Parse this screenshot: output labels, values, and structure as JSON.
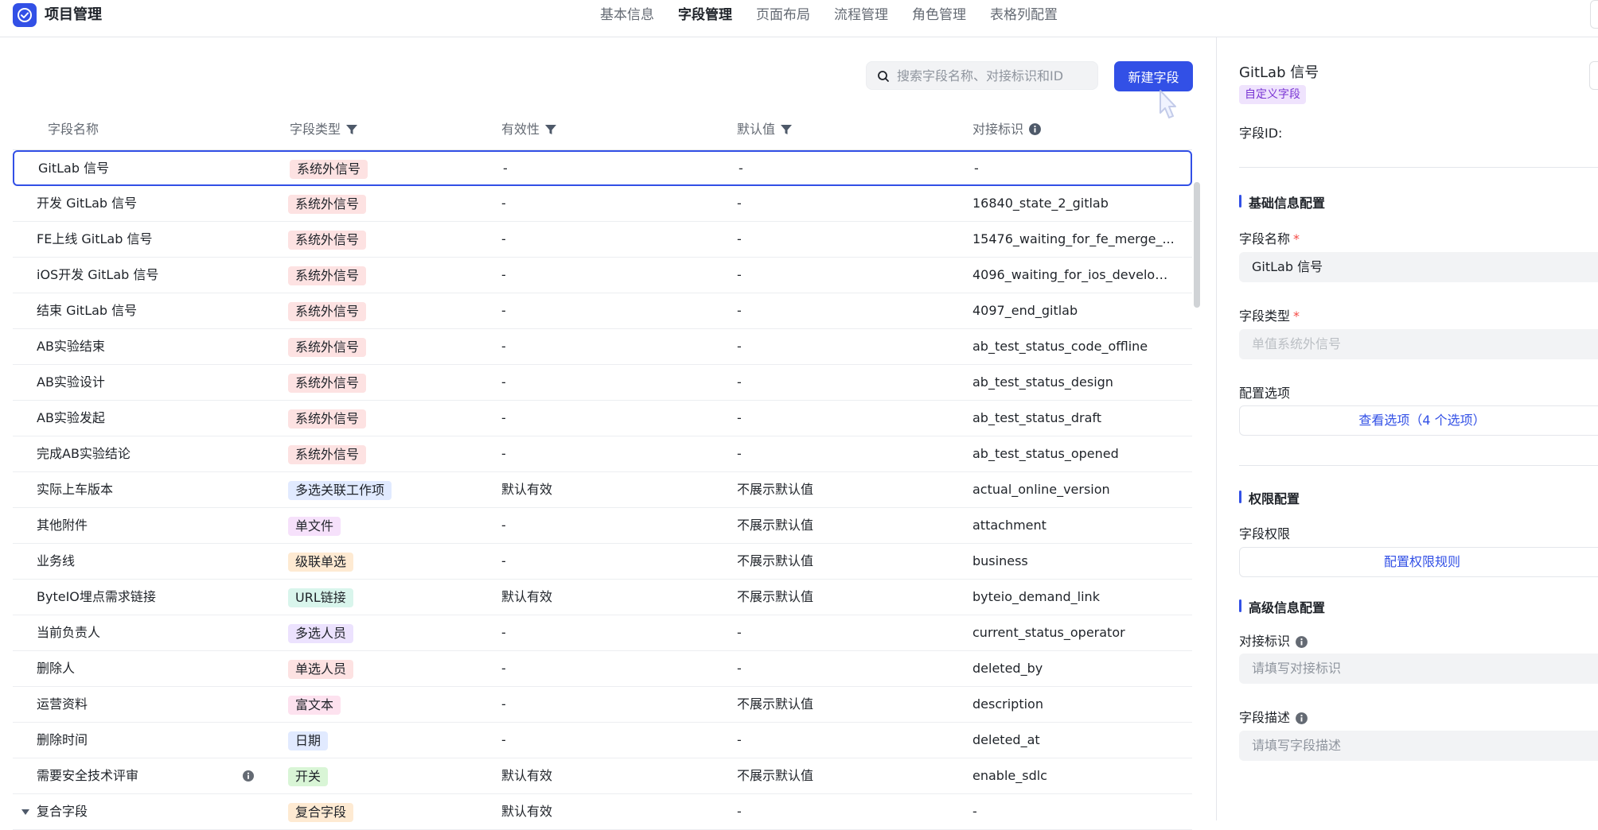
{
  "app": {
    "title": "项目管理"
  },
  "nav": [
    {
      "label": "基本信息",
      "active": false
    },
    {
      "label": "字段管理",
      "active": true
    },
    {
      "label": "页面布局",
      "active": false
    },
    {
      "label": "流程管理",
      "active": false
    },
    {
      "label": "角色管理",
      "active": false
    },
    {
      "label": "表格列配置",
      "active": false
    }
  ],
  "toolbar": {
    "search_placeholder": "搜索字段名称、对接标识和ID",
    "search_value": "",
    "new_button": "新建字段"
  },
  "table": {
    "headers": {
      "name": "字段名称",
      "type": "字段类型",
      "validity": "有效性",
      "default": "默认值",
      "key": "对接标识"
    },
    "rows": [
      {
        "name": "GitLab 信号",
        "type": "系统外信号",
        "validity": "-",
        "default": "-",
        "key": "-"
      },
      {
        "name": "开发 GitLab 信号",
        "type": "系统外信号",
        "validity": "-",
        "default": "-",
        "key": "16840_state_2_gitlab"
      },
      {
        "name": "FE上线 GitLab 信号",
        "type": "系统外信号",
        "validity": "-",
        "default": "-",
        "key": "15476_waiting_for_fe_merge_..."
      },
      {
        "name": "iOS开发 GitLab 信号",
        "type": "系统外信号",
        "validity": "-",
        "default": "-",
        "key": "4096_waiting_for_ios_develop..."
      },
      {
        "name": "结束 GitLab 信号",
        "type": "系统外信号",
        "validity": "-",
        "default": "-",
        "key": "4097_end_gitlab"
      },
      {
        "name": "AB实验结束",
        "type": "系统外信号",
        "validity": "-",
        "default": "-",
        "key": "ab_test_status_code_offline"
      },
      {
        "name": "AB实验设计",
        "type": "系统外信号",
        "validity": "-",
        "default": "-",
        "key": "ab_test_status_design"
      },
      {
        "name": "AB实验发起",
        "type": "系统外信号",
        "validity": "-",
        "default": "-",
        "key": "ab_test_status_draft"
      },
      {
        "name": "完成AB实验结论",
        "type": "系统外信号",
        "validity": "-",
        "default": "-",
        "key": "ab_test_status_opened"
      },
      {
        "name": "实际上车版本",
        "type": "多选关联工作项",
        "validity": "默认有效",
        "default": "不展示默认值",
        "key": "actual_online_version"
      },
      {
        "name": "其他附件",
        "type": "单文件",
        "validity": "-",
        "default": "不展示默认值",
        "key": "attachment"
      },
      {
        "name": "业务线",
        "type": "级联单选",
        "validity": "-",
        "default": "不展示默认值",
        "key": "business"
      },
      {
        "name": "ByteIO埋点需求链接",
        "type": "URL链接",
        "validity": "默认有效",
        "default": "不展示默认值",
        "key": "byteio_demand_link"
      },
      {
        "name": "当前负责人",
        "type": "多选人员",
        "validity": "-",
        "default": "-",
        "key": "current_status_operator"
      },
      {
        "name": "删除人",
        "type": "单选人员",
        "validity": "-",
        "default": "-",
        "key": "deleted_by"
      },
      {
        "name": "运营资料",
        "type": "富文本",
        "validity": "-",
        "default": "不展示默认值",
        "key": "description"
      },
      {
        "name": "删除时间",
        "type": "日期",
        "validity": "-",
        "default": "-",
        "key": "deleted_at"
      },
      {
        "name": "需要安全技术评审",
        "type": "开关",
        "validity": "默认有效",
        "default": "不展示默认值",
        "key": "enable_sdlc"
      },
      {
        "name": "复合字段",
        "type": "复合字段",
        "validity": "默认有效",
        "default": "-",
        "key": "-"
      }
    ]
  },
  "tag_colors": {
    "系统外信号": {
      "bg": "#fde2e2",
      "fg": "#1f2329"
    },
    "多选关联工作项": {
      "bg": "#e1eaff",
      "fg": "#1f2329"
    },
    "单文件": {
      "bg": "#f6e1fb",
      "fg": "#1f2329"
    },
    "级联单选": {
      "bg": "#feead2",
      "fg": "#1f2329"
    },
    "URL链接": {
      "bg": "#d9f5ec",
      "fg": "#1f2329"
    },
    "多选人员": {
      "bg": "#ece2fe",
      "fg": "#1f2329"
    },
    "单选人员": {
      "bg": "#fde2e2",
      "fg": "#1f2329"
    },
    "富文本": {
      "bg": "#fde2ef",
      "fg": "#1f2329"
    },
    "日期": {
      "bg": "#e1eaff",
      "fg": "#1f2329"
    },
    "开关": {
      "bg": "#d9f5d6",
      "fg": "#1f2329"
    },
    "复合字段": {
      "bg": "#feead2",
      "fg": "#1f2329"
    }
  },
  "panel": {
    "title": "GitLab 信号",
    "badge": "自定义字段",
    "field_id_label": "字段ID:",
    "section_basic": "基础信息配置",
    "name_label": "字段名称",
    "name_value": "GitLab 信号",
    "type_label": "字段类型",
    "type_value": "单值系统外信号",
    "options_label": "配置选项",
    "options_link": "查看选项（4 个选项）",
    "section_permission": "权限配置",
    "permission_label": "字段权限",
    "permission_link": "配置权限规则",
    "section_advanced": "高级信息配置",
    "key_label": "对接标识",
    "key_placeholder": "请填写对接标识",
    "desc_label": "字段描述",
    "desc_placeholder": "请填写字段描述"
  },
  "colors": {
    "accent": "#3250e6",
    "required": "#f54a45"
  }
}
